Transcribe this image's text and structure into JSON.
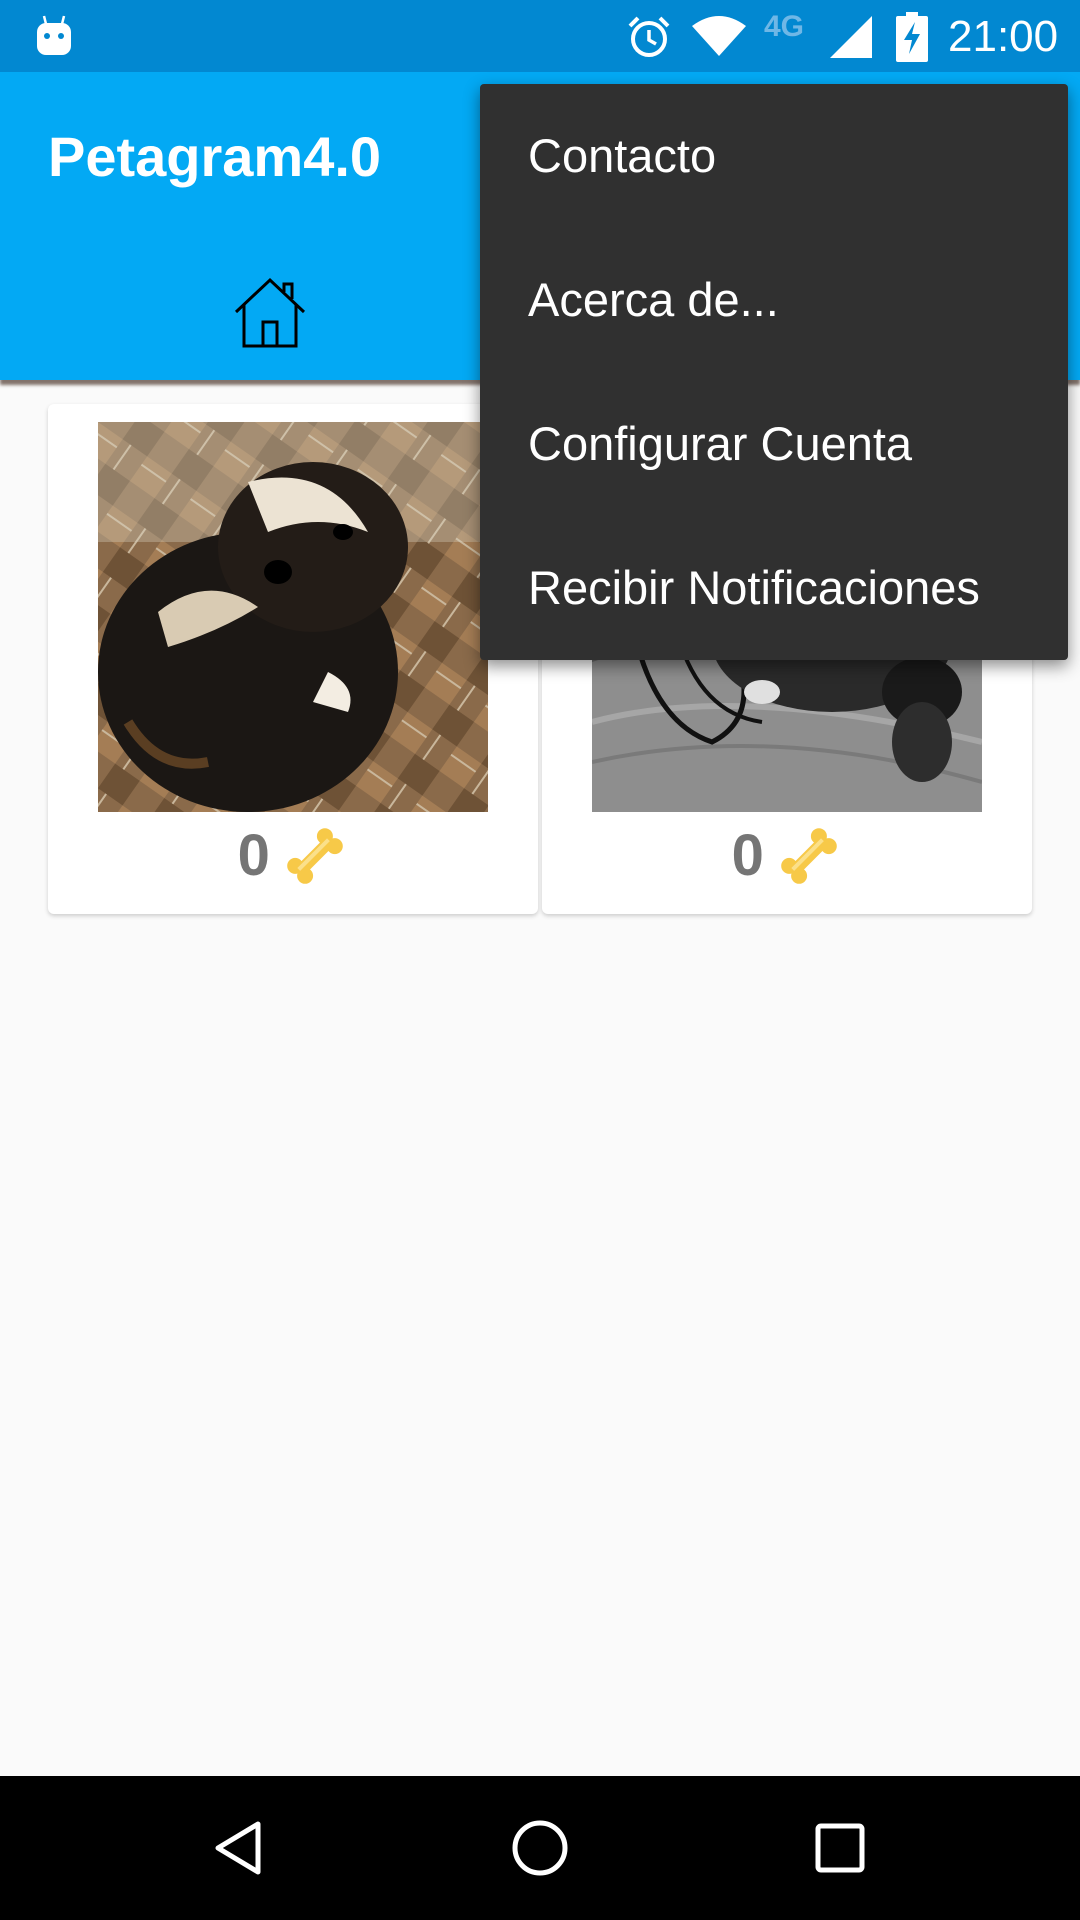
{
  "status_bar": {
    "time": "21:00",
    "network_type": "4G",
    "icons": [
      "android-debug-icon",
      "alarm-icon",
      "wifi-icon",
      "signal-icon",
      "battery-charging-icon"
    ]
  },
  "app_bar": {
    "title": "Petagram4.0",
    "background_color": "#03a9f4",
    "tabs": [
      {
        "icon": "home-icon"
      },
      {
        "icon": "profile-icon"
      }
    ]
  },
  "overflow_menu": {
    "background_color": "#303030",
    "items": [
      {
        "label": "Contacto"
      },
      {
        "label": "Acerca de..."
      },
      {
        "label": "Configurar Cuenta"
      },
      {
        "label": "Recibir Notificaciones"
      }
    ]
  },
  "pet_cards": [
    {
      "photo": "dog-photo-color",
      "likes": "0",
      "icon": "bone-icon"
    },
    {
      "photo": "dog-photo-bw",
      "likes": "0",
      "icon": "bone-icon"
    }
  ],
  "nav_bar": {
    "buttons": [
      "back-icon",
      "home-circle-icon",
      "recents-icon"
    ]
  }
}
